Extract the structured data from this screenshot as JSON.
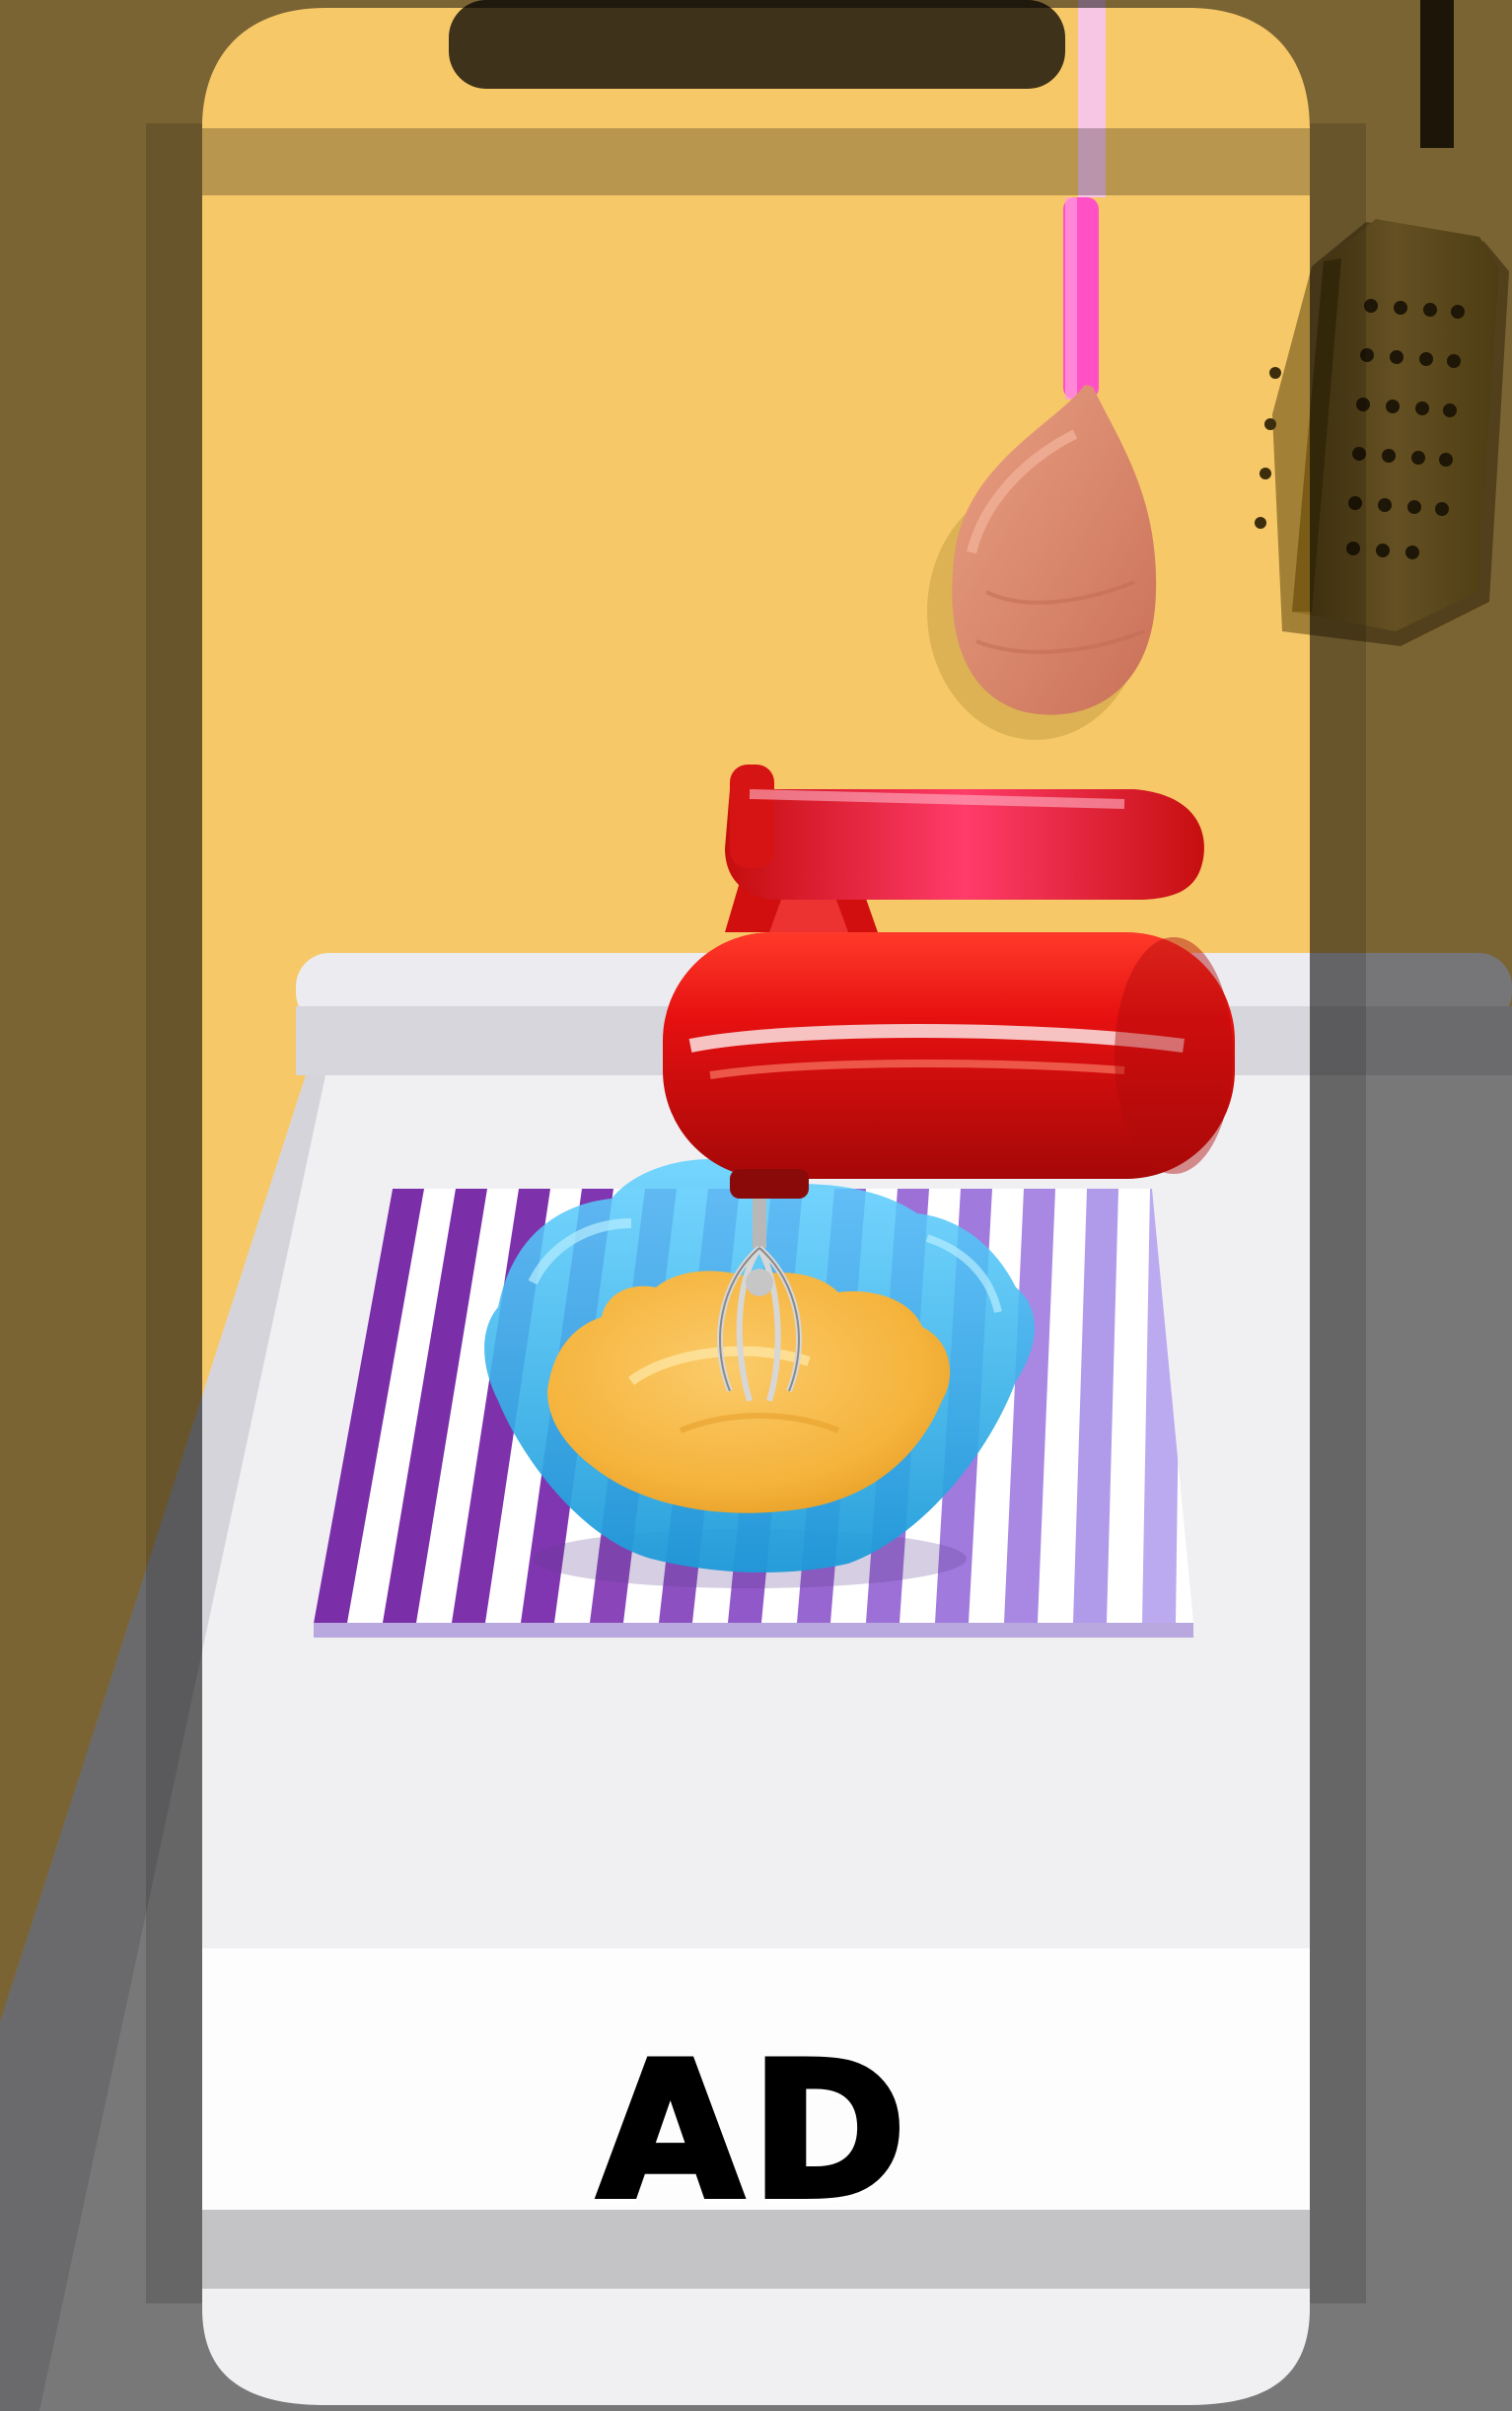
{
  "ad_banner": {
    "label": "AD"
  },
  "scene": {
    "description_tokens": [
      "wooden-spoon",
      "grater",
      "hand-mixer",
      "glass-bowl",
      "batter",
      "striped-cloth",
      "counter"
    ],
    "colors": {
      "wall": "#f7c96a",
      "counter": "#f2f2f4",
      "counter_edge": "#e0e0e6",
      "mixer": "#e01212",
      "bowl": "#38b8ea",
      "batter": "#f5b23a",
      "cloth_stripe_dark": "#7b2fa9",
      "cloth_stripe_light": "#a48ee6",
      "spoon": "#d98a6a",
      "spoon_handle": "#ff55c8",
      "grater": "#c99a2e",
      "phone_frame": "#000000"
    }
  }
}
